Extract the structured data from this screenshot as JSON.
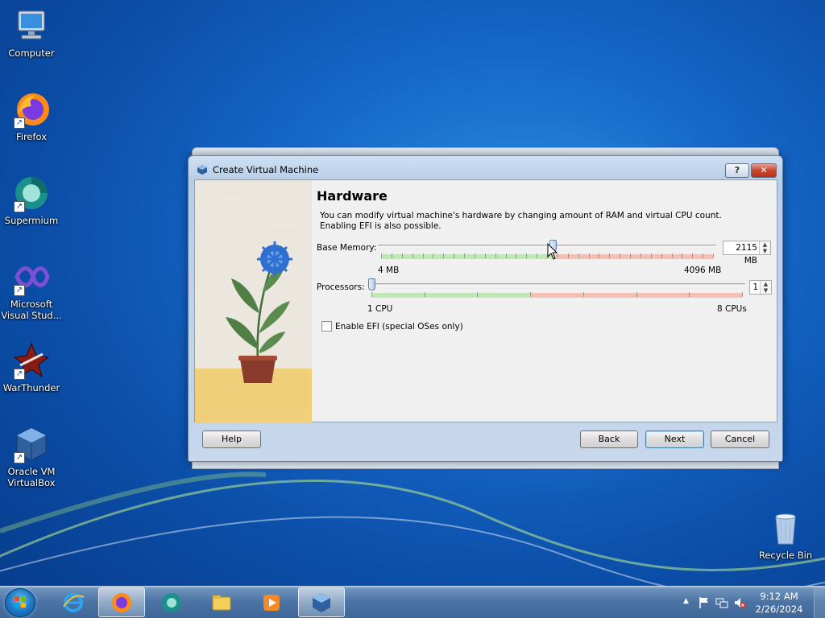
{
  "desktop": {
    "icons": [
      {
        "label": "Computer"
      },
      {
        "label": "Firefox"
      },
      {
        "label": "Supermium"
      },
      {
        "label": "Microsoft Visual Stud..."
      },
      {
        "label": "WarThunder"
      },
      {
        "label": "Oracle VM VirtualBox"
      },
      {
        "label": "Recycle Bin"
      }
    ]
  },
  "dialog": {
    "title": "Create Virtual Machine",
    "help_glyph": "?",
    "close_glyph": "✕",
    "heading": "Hardware",
    "description": "You can modify virtual machine's hardware by changing amount of RAM and virtual CPU count. Enabling EFI is also possible.",
    "memory": {
      "label": "Base Memory:",
      "value": "2115 MB",
      "min_label": "4 MB",
      "max_label": "4096 MB",
      "value_mb": 2115,
      "min_mb": 4,
      "max_mb": 4096
    },
    "processors": {
      "label": "Processors:",
      "value": "1",
      "min_label": "1 CPU",
      "max_label": "8 CPUs",
      "count": 1,
      "min": 1,
      "max": 8
    },
    "efi": {
      "label": "Enable EFI (special OSes only)",
      "checked": false
    },
    "buttons": {
      "help": "Help",
      "back": "Back",
      "next": "Next",
      "cancel": "Cancel"
    }
  },
  "taskbar": {
    "apps": [
      "Internet Explorer",
      "Firefox",
      "Supermium",
      "File Explorer",
      "Media Player",
      "VirtualBox"
    ],
    "time": "9:12 AM",
    "date": "2/26/2024"
  },
  "colors": {
    "accent": "#1566c6",
    "green_zone": "#bfe8b5",
    "red_zone": "#f4c0b4"
  }
}
